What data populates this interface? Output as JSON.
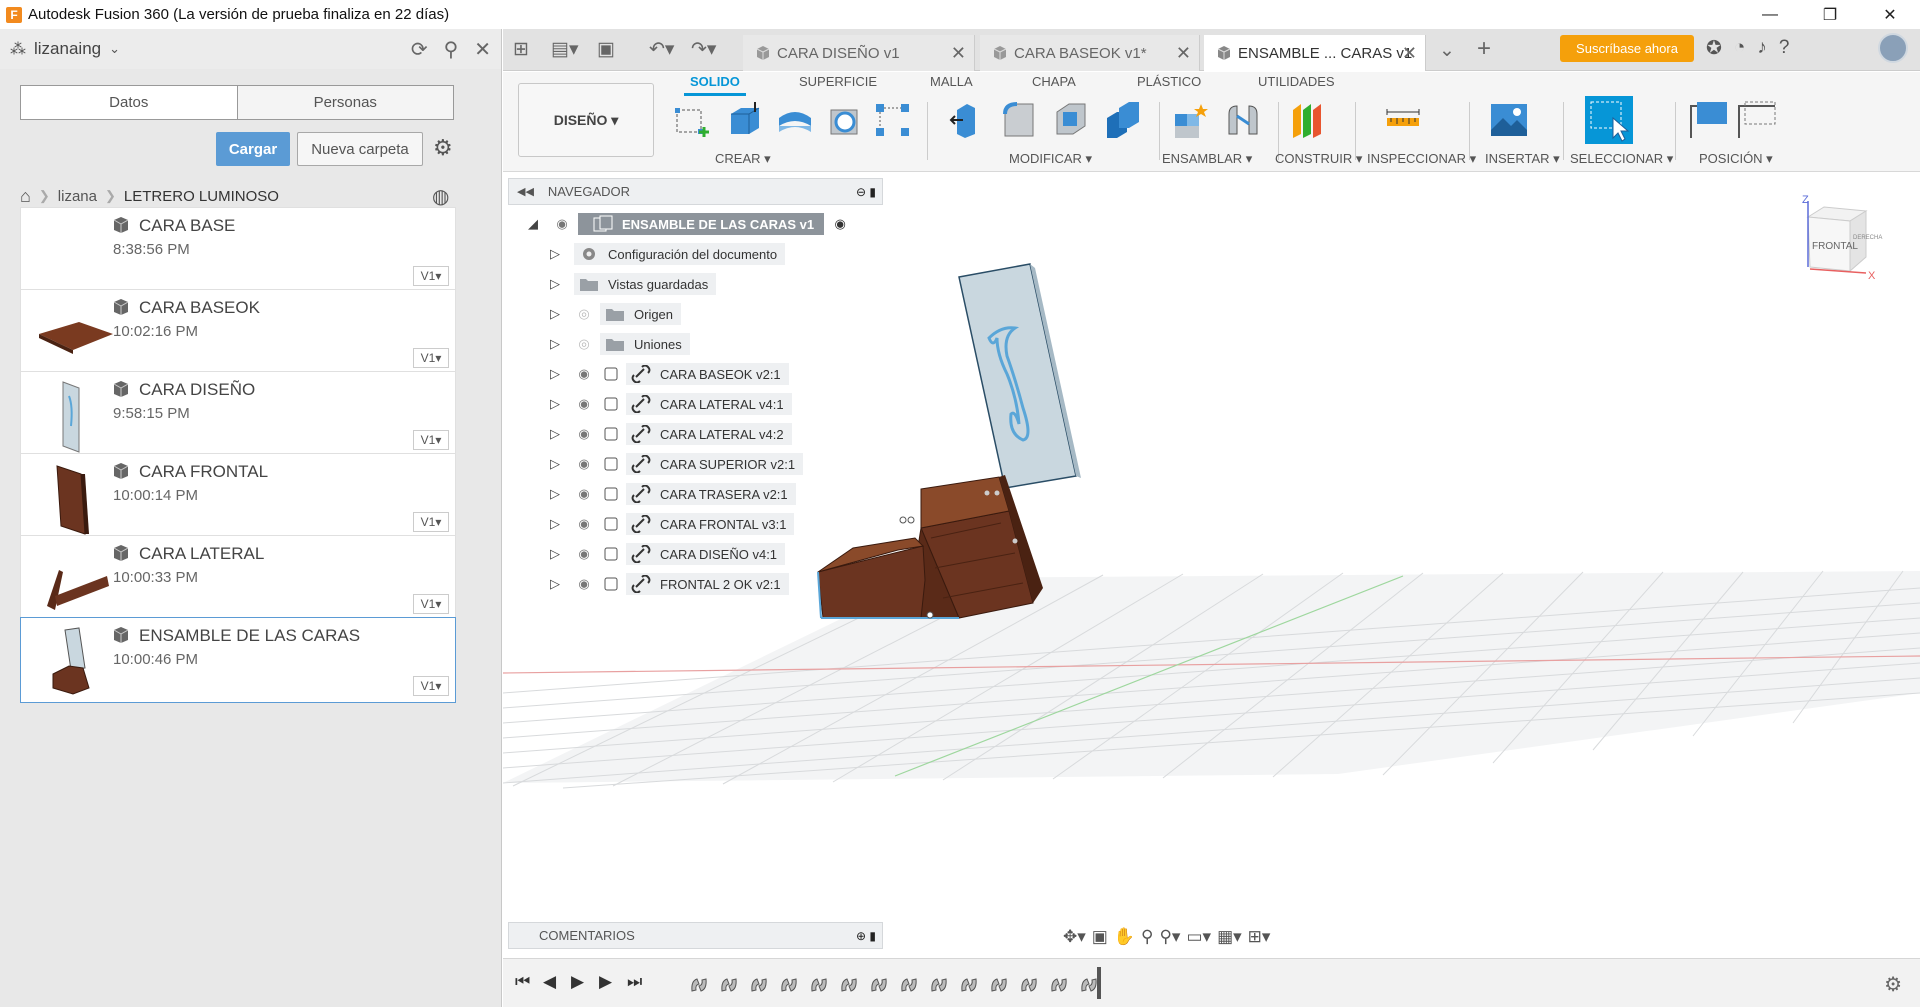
{
  "window": {
    "app_logo": "F",
    "title": "Autodesk Fusion 360 (La versión de prueba finaliza en 22 días)",
    "minimize": "—",
    "restore": "❐",
    "close": "✕"
  },
  "data_panel": {
    "user": "lizanaing",
    "tabs": [
      "Datos",
      "Personas"
    ],
    "upload_label": "Cargar",
    "new_folder_label": "Nueva carpeta",
    "breadcrumb": [
      "lizana",
      "LETRERO LUMINOSO"
    ],
    "files": [
      {
        "name": "CARA BASE",
        "time": "8:38:56 PM",
        "version": "V1",
        "thumb": "none",
        "selected": false
      },
      {
        "name": "CARA BASEOK",
        "time": "10:02:16 PM",
        "version": "V1",
        "thumb": "base",
        "selected": false
      },
      {
        "name": "CARA DISEÑO",
        "time": "9:58:15 PM",
        "version": "V1",
        "thumb": "design",
        "selected": false
      },
      {
        "name": "CARA FRONTAL",
        "time": "10:00:14 PM",
        "version": "V1",
        "thumb": "frontal",
        "selected": false
      },
      {
        "name": "CARA LATERAL",
        "time": "10:00:33 PM",
        "version": "V1",
        "thumb": "lateral",
        "selected": false
      },
      {
        "name": "ENSAMBLE DE LAS CARAS",
        "time": "10:00:46 PM",
        "version": "V1",
        "thumb": "assembly",
        "selected": true
      }
    ]
  },
  "doc_tabs": [
    {
      "label": "CARA DISEÑO v1",
      "active": false
    },
    {
      "label": "CARA BASEOK v1*",
      "active": false
    },
    {
      "label": "ENSAMBLE ... CARAS v1",
      "active": true
    }
  ],
  "subscribe_label": "Suscríbase ahora",
  "toolbar": {
    "workspace": "DISEÑO ▾",
    "tabs": [
      "SOLIDO",
      "SUPERFICIE",
      "MALLA",
      "CHAPA",
      "PLÁSTICO",
      "UTILIDADES"
    ],
    "active_tab": "SOLIDO",
    "groups": [
      "CREAR ▾",
      "MODIFICAR ▾",
      "ENSAMBLAR ▾",
      "CONSTRUIR ▾",
      "INSPECCIONAR ▾",
      "INSERTAR ▾",
      "SELECCIONAR ▾",
      "POSICIÓN ▾"
    ]
  },
  "browser": {
    "title": "NAVEGADOR",
    "root": "ENSAMBLE DE LAS CARAS v1",
    "folders": [
      {
        "label": "Configuración del documento",
        "icon": "gear-icon",
        "eye": "none"
      },
      {
        "label": "Vistas guardadas",
        "icon": "folder-icon",
        "eye": "none"
      },
      {
        "label": "Origen",
        "icon": "folder-icon",
        "eye": "hidden"
      },
      {
        "label": "Uniones",
        "icon": "folder-icon",
        "eye": "hidden"
      }
    ],
    "components": [
      "CARA BASEOK v2:1",
      "CARA LATERAL v4:1",
      "CARA LATERAL v4:2",
      "CARA SUPERIOR v2:1",
      "CARA TRASERA v2:1",
      "CARA FRONTAL v3:1",
      "CARA DISEÑO v4:1",
      "FRONTAL 2 OK v2:1"
    ]
  },
  "viewcube": {
    "face": "FRONTAL",
    "side": "DERECHA",
    "z": "Z",
    "x": "X"
  },
  "comments_label": "COMENTARIOS",
  "colors": {
    "accent": "#0696d7",
    "subscribe": "#f5a00b",
    "upload": "#5b9bd5",
    "wood": "#6b3420"
  }
}
